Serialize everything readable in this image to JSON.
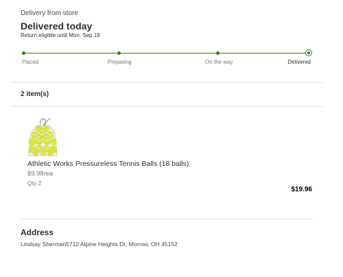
{
  "delivery": {
    "method_label": "Delivery from store",
    "status_title": "Delivered today",
    "return_note": "Return eligible until Mon, Sep 18"
  },
  "tracker": {
    "steps": [
      "Placed",
      "Preparing",
      "On the way",
      "Delivered"
    ],
    "current_step": "Delivered",
    "accent_color": "#2a8703"
  },
  "order": {
    "items_count_label": "2 item(s)",
    "items": [
      {
        "image_icon": "tennis-balls-mesh-bag-image",
        "name": "Athletic Works Pressureless Tennis Balls (18 balls)",
        "unit_price": "$9.98/ea",
        "quantity": "Qty 2",
        "line_total": "$19.96"
      }
    ]
  },
  "address": {
    "heading": "Address",
    "text": "Lindsay Sherman5712 Alpine Heights Dr, Morrow, OH 45152"
  }
}
